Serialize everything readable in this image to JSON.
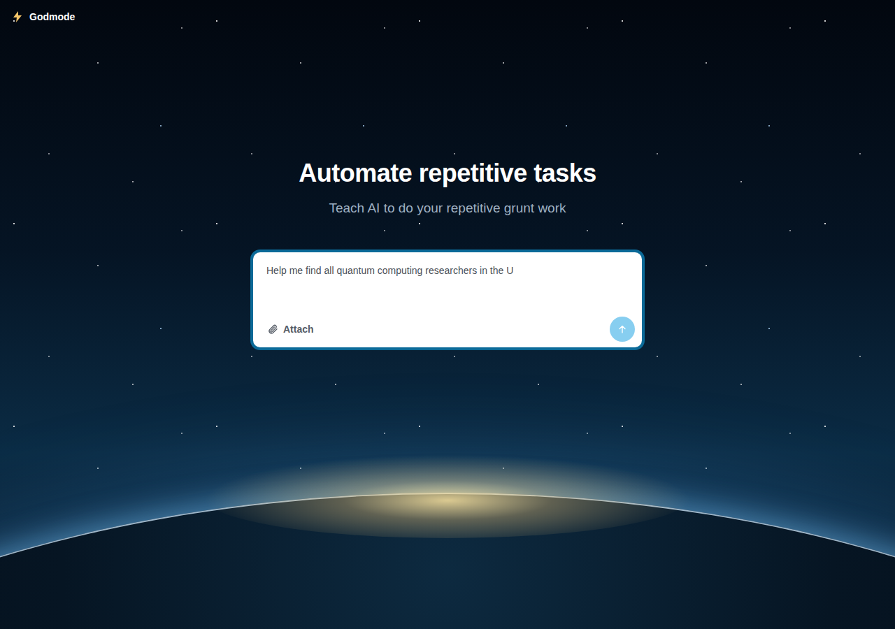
{
  "app": {
    "name": "Godmode"
  },
  "hero": {
    "title": "Automate repetitive tasks",
    "subtitle": "Teach AI to do your repetitive grunt work"
  },
  "prompt": {
    "value": "Help me find all quantum computing researchers in the U",
    "attach_label": "Attach",
    "send_disabled": true
  }
}
